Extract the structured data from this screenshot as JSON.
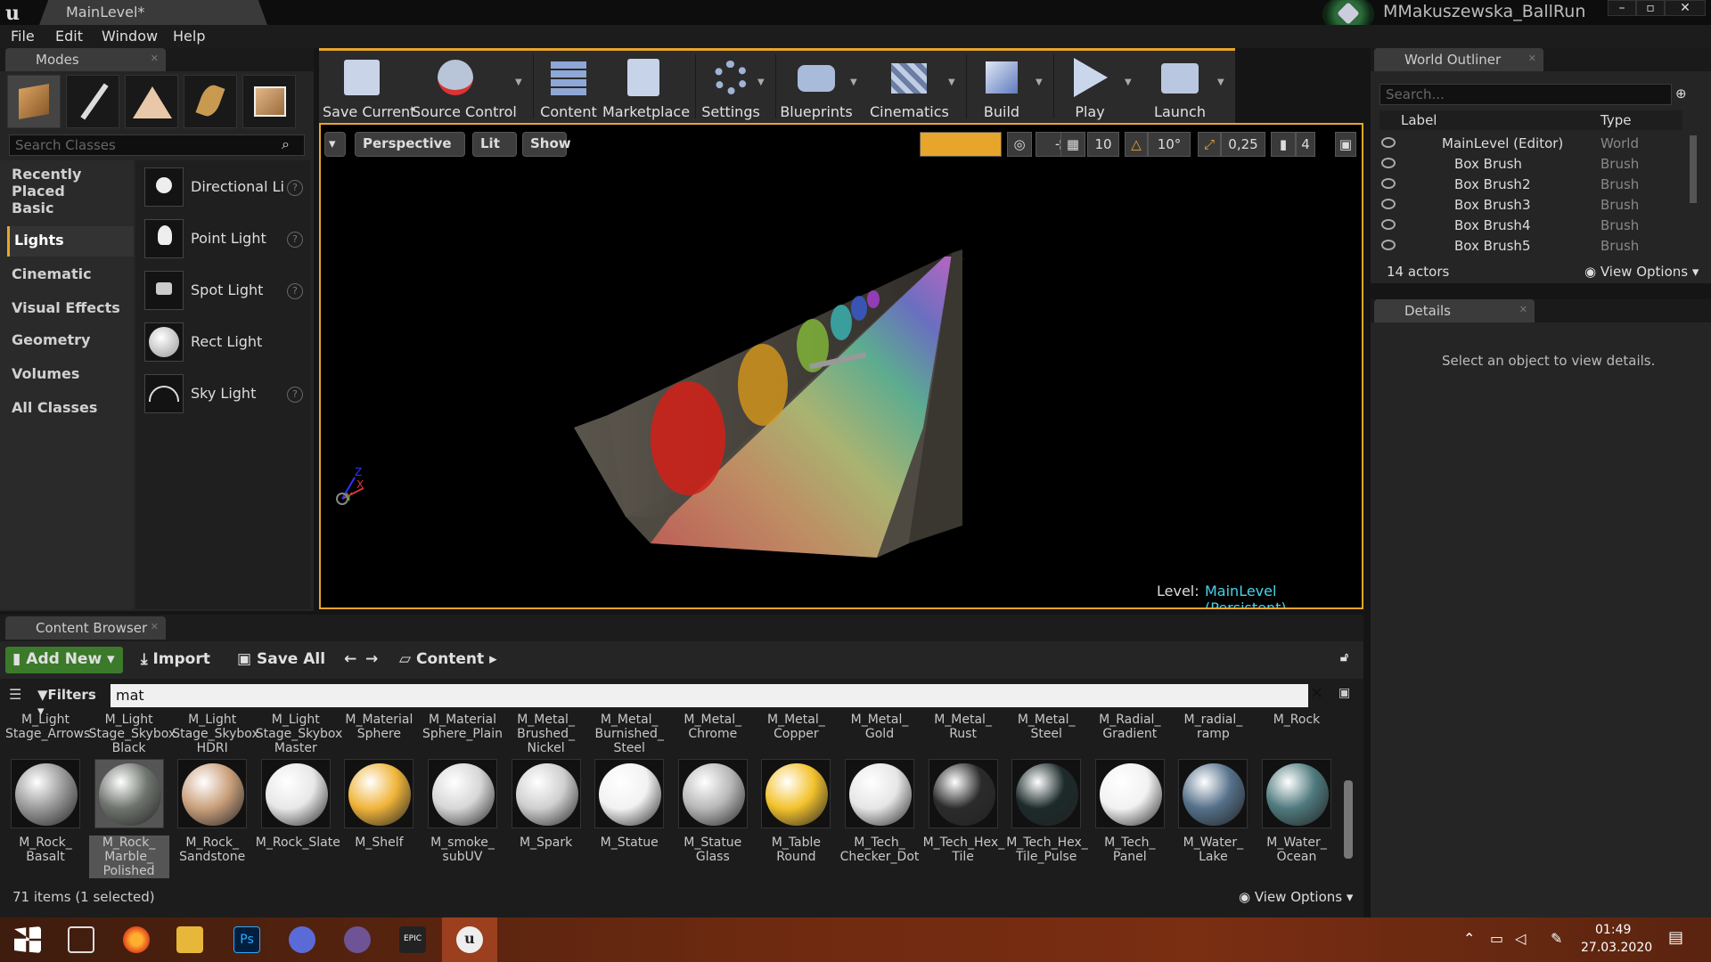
{
  "window": {
    "tab_title": "MainLevel*",
    "project_name": "MMakuszewska_BallRun"
  },
  "menu": [
    "File",
    "Edit",
    "Window",
    "Help"
  ],
  "modes": {
    "tab_label": "Modes",
    "search_placeholder": "Search Classes",
    "categories": [
      "Recently Placed",
      "Basic",
      "Lights",
      "Cinematic",
      "Visual Effects",
      "Geometry",
      "Volumes",
      "All Classes"
    ],
    "active_category": "Lights",
    "lights": [
      "Directional Light",
      "Point Light",
      "Spot Light",
      "Rect Light",
      "Sky Light"
    ]
  },
  "toolbar": {
    "save_current": "Save Current",
    "source_control": "Source Control",
    "content": "Content",
    "marketplace": "Marketplace",
    "settings": "Settings",
    "blueprints": "Blueprints",
    "cinematics": "Cinematics",
    "build": "Build",
    "play": "Play",
    "launch": "Launch"
  },
  "viewport": {
    "perspective": "Perspective",
    "lit": "Lit",
    "show": "Show",
    "grid_snap": "10",
    "rotation_snap": "10°",
    "scale_snap": "0,25",
    "camera_speed": "4",
    "level_label": "Level:",
    "level_name": "MainLevel (Persistent)",
    "axis_x": "X",
    "axis_y": "Y",
    "axis_z": "Z"
  },
  "outliner": {
    "tab_label": "World Outliner",
    "search_placeholder": "Search...",
    "col_label": "Label",
    "col_type": "Type",
    "rows": [
      {
        "label": "MainLevel (Editor)",
        "type": "World"
      },
      {
        "label": "Box Brush",
        "type": "Brush"
      },
      {
        "label": "Box Brush2",
        "type": "Brush"
      },
      {
        "label": "Box Brush3",
        "type": "Brush"
      },
      {
        "label": "Box Brush4",
        "type": "Brush"
      },
      {
        "label": "Box Brush5",
        "type": "Brush"
      }
    ],
    "actor_count": "14 actors",
    "view_options": "View Options"
  },
  "details": {
    "tab_label": "Details",
    "empty_message": "Select an object to view details."
  },
  "content_browser": {
    "tab_label": "Content Browser",
    "add_new": "Add New",
    "import": "Import",
    "save_all": "Save All",
    "path": "Content",
    "filters": "Filters",
    "search_value": "mat",
    "top_row": [
      "M_Light Stage_Arrows",
      "M_Light Stage_Skybox Black",
      "M_Light Stage_Skybox HDRI",
      "M_Light Stage_Skybox Master",
      "M_Material Sphere",
      "M_Material Sphere_Plain",
      "M_Metal_ Brushed_ Nickel",
      "M_Metal_ Burnished_ Steel",
      "M_Metal_ Chrome",
      "M_Metal_ Copper",
      "M_Metal_ Gold",
      "M_Metal_ Rust",
      "M_Metal_ Steel",
      "M_Radial_ Gradient",
      "M_radial_ ramp",
      "M_Rock"
    ],
    "bottom_row": [
      "M_Rock_ Basalt",
      "M_Rock_ Marble_ Polished",
      "M_Rock_ Sandstone",
      "M_Rock_Slate",
      "M_Shelf",
      "M_smoke_ subUV",
      "M_Spark",
      "M_Statue",
      "M_Statue Glass",
      "M_Table Round",
      "M_Tech_ Checker_Dot",
      "M_Tech_Hex_ Tile",
      "M_Tech_Hex_ Tile_Pulse",
      "M_Tech_ Panel",
      "M_Water_ Lake",
      "M_Water_ Ocean"
    ],
    "status": "71 items (1 selected)",
    "view_options": "View Options"
  },
  "taskbar": {
    "time": "01:49",
    "date": "27.03.2020"
  }
}
